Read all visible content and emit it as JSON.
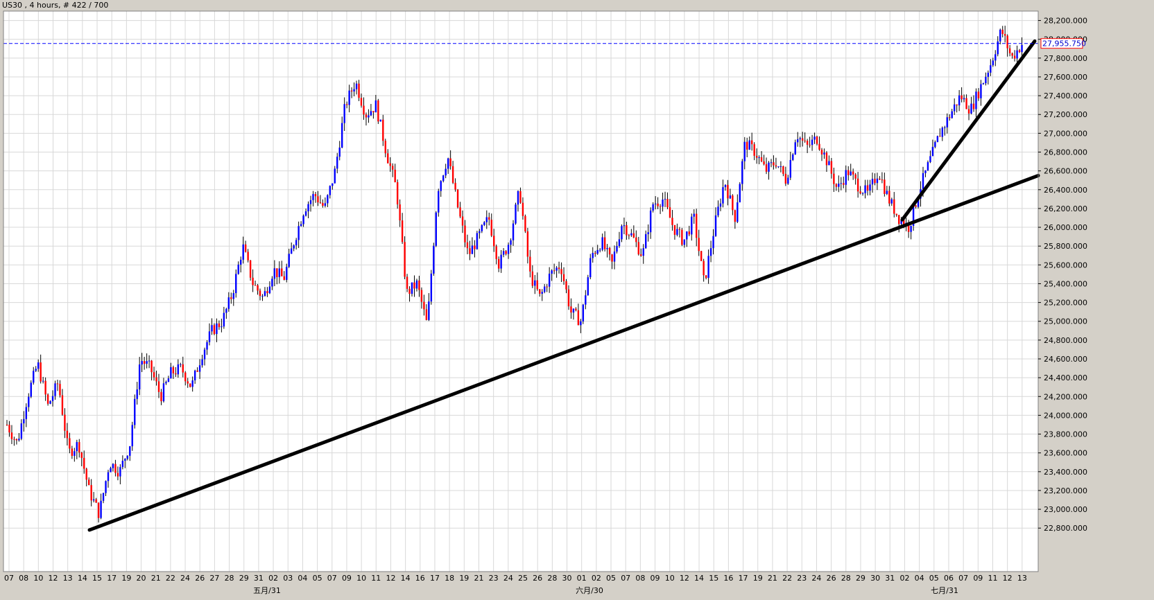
{
  "chart_data": {
    "type": "candlestick",
    "title": "US30 , 4 hours, # 422 / 700",
    "ylim": [
      22750,
      28300
    ],
    "y_ticks": [
      22800,
      23000,
      23200,
      23400,
      23600,
      23800,
      24000,
      24200,
      24400,
      24600,
      24800,
      25000,
      25200,
      25400,
      25600,
      25800,
      26000,
      26200,
      26400,
      26600,
      26800,
      27000,
      27200,
      27400,
      27600,
      27800,
      28000,
      28200
    ],
    "y_tick_labels": [
      "22,800.000",
      "23,000.000",
      "23,200.000",
      "23,400.000",
      "23,600.000",
      "23,800.000",
      "24,000.000",
      "24,200.000",
      "24,400.000",
      "24,600.000",
      "24,800.000",
      "25,000.000",
      "25,200.000",
      "25,400.000",
      "25,600.000",
      "25,800.000",
      "26,000.000",
      "26,200.000",
      "26,400.000",
      "26,600.000",
      "26,800.000",
      "27,000.000",
      "27,200.000",
      "27,400.000",
      "27,600.000",
      "27,800.000",
      "28,000.000",
      "28,200.000"
    ],
    "x_tick_labels": [
      "07",
      "08",
      "10",
      "12",
      "13",
      "14",
      "15",
      "17",
      "19",
      "20",
      "21",
      "22",
      "24",
      "26",
      "27",
      "28",
      "29",
      "31",
      "02",
      "03",
      "04",
      "05",
      "07",
      "09",
      "10",
      "11",
      "12",
      "14",
      "16",
      "17",
      "18",
      "19",
      "21",
      "23",
      "24",
      "25",
      "26",
      "28",
      "30",
      "01",
      "02",
      "05",
      "07",
      "08",
      "09",
      "10",
      "12",
      "14",
      "15",
      "16",
      "17",
      "19",
      "21",
      "22",
      "23",
      "24",
      "26",
      "28",
      "29",
      "30",
      "31",
      "02",
      "04",
      "05",
      "06",
      "07",
      "09",
      "11",
      "12",
      "13"
    ],
    "month_labels": [
      "五月/31",
      "六月/30",
      "七月/31"
    ],
    "current_price": 27955.75,
    "current_price_label": "27,955.750",
    "colors": {
      "up": "#0000ff",
      "down": "#ff0000",
      "wick": "#000000",
      "price_line": "#0000ff",
      "trendline": "#000000",
      "grid": "#d8d8d8",
      "price_box_border": "#ff0000"
    },
    "candles": {
      "close_path": [
        23900,
        23700,
        24200,
        24550,
        24100,
        24350,
        23600,
        23700,
        23200,
        22950,
        23500,
        23400,
        23700,
        24600,
        24500,
        24200,
        24450,
        24500,
        24300,
        24650,
        24900,
        25000,
        25300,
        25800,
        25400,
        25250,
        25550,
        25450,
        25850,
        26200,
        26350,
        26200,
        26600,
        27300,
        27550,
        27200,
        27300,
        26800,
        26400,
        25300,
        25400,
        24950,
        26400,
        26750,
        26200,
        25700,
        25900,
        26100,
        25600,
        25850,
        26400,
        25500,
        25250,
        25500,
        25600,
        25100,
        25000,
        25700,
        25850,
        25600,
        26050,
        25900,
        25700,
        26250,
        26300,
        26000,
        25850,
        26100,
        25400,
        26000,
        26500,
        26100,
        26900,
        26800,
        26600,
        26700,
        26500,
        27000,
        26850,
        26950,
        26700,
        26400,
        26600,
        26450,
        26350,
        26600,
        26300,
        26100,
        26000,
        26400,
        26700,
        27000,
        27200,
        27400,
        27250,
        27500,
        27750,
        28100,
        27800,
        27950
      ],
      "count": 422,
      "seed": 7
    },
    "trendlines": [
      {
        "x0": 129,
        "y0": 22780,
        "x1": 1497,
        "y1": 26550
      },
      {
        "x0": 1301,
        "y0": 26080,
        "x1": 1492,
        "y1": 27980
      }
    ]
  }
}
